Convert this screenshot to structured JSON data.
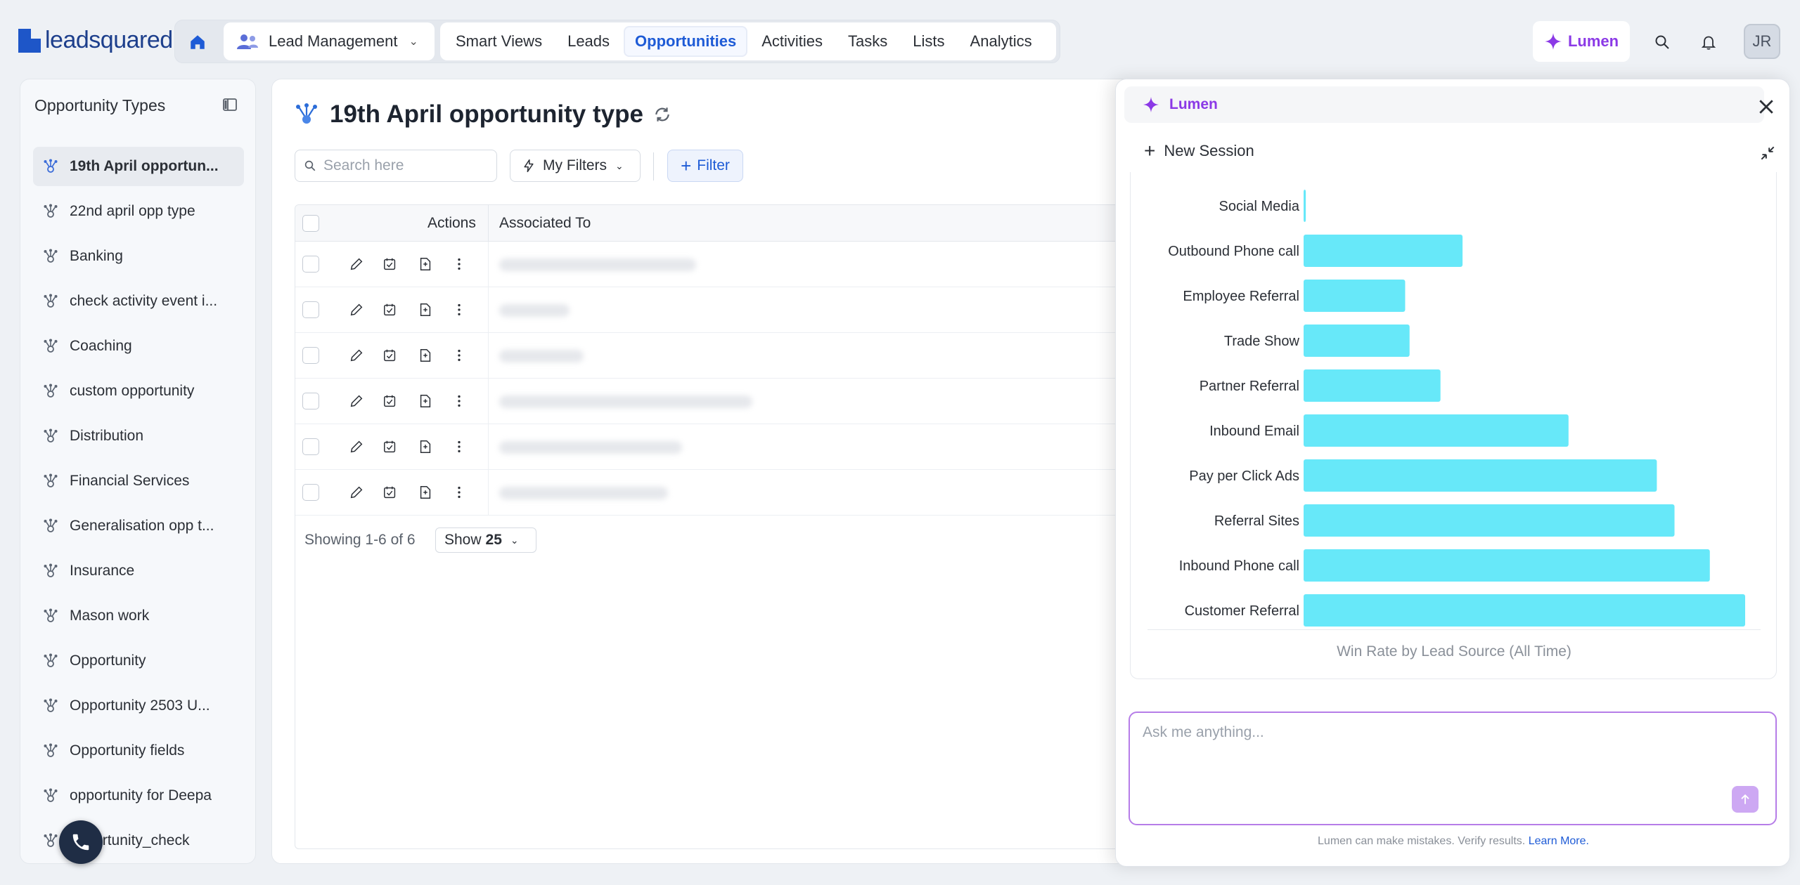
{
  "brand": {
    "logo_text": "leadsquared"
  },
  "nav": {
    "module": "Lead Management",
    "tabs": [
      {
        "label": "Smart Views"
      },
      {
        "label": "Leads"
      },
      {
        "label": "Opportunities",
        "active": true
      },
      {
        "label": "Activities"
      },
      {
        "label": "Tasks"
      },
      {
        "label": "Lists"
      },
      {
        "label": "Analytics"
      }
    ],
    "lumen_label": "Lumen",
    "avatar_initials": "JR"
  },
  "sidebar": {
    "title": "Opportunity Types",
    "items": [
      {
        "label": "19th April opportun...",
        "active": true
      },
      {
        "label": "22nd april opp type"
      },
      {
        "label": "Banking"
      },
      {
        "label": "check activity event i..."
      },
      {
        "label": "Coaching"
      },
      {
        "label": "custom opportunity"
      },
      {
        "label": "Distribution"
      },
      {
        "label": "Financial Services"
      },
      {
        "label": "Generalisation opp t..."
      },
      {
        "label": "Insurance"
      },
      {
        "label": "Mason work"
      },
      {
        "label": "Opportunity"
      },
      {
        "label": "Opportunity 2503 U..."
      },
      {
        "label": "Opportunity fields"
      },
      {
        "label": "opportunity for Deepa"
      },
      {
        "label": "opportunity_check"
      }
    ]
  },
  "main": {
    "title": "19th April opportunity type",
    "search_placeholder": "Search here",
    "my_filters_label": "My Filters",
    "filter_label": "Filter",
    "columns": {
      "actions": "Actions",
      "associated_to": "Associated To"
    },
    "row_count": 6,
    "showing_text": "Showing 1-6 of 6",
    "show_label": "Show",
    "page_size": "25"
  },
  "lumen": {
    "title": "Lumen",
    "new_session_label": "New Session",
    "ask_placeholder": "Ask me anything...",
    "disclaimer": "Lumen can make mistakes. Verify results.",
    "learn_more": "Learn More.",
    "bar_color": "#67e8f9"
  },
  "chart_data": {
    "type": "bar",
    "orientation": "horizontal",
    "title": "Win Rate by Lead Source (All Time)",
    "categories": [
      "Social Media",
      "Outbound Phone call",
      "Employee Referral",
      "Trade Show",
      "Partner Referral",
      "Inbound Email",
      "Pay per Click Ads",
      "Referral Sites",
      "Inbound Phone call",
      "Customer Referral"
    ],
    "values": [
      0.5,
      36,
      23,
      24,
      31,
      60,
      80,
      84,
      92,
      100
    ],
    "xlim": [
      0,
      100
    ],
    "grid": false,
    "legend": false
  }
}
